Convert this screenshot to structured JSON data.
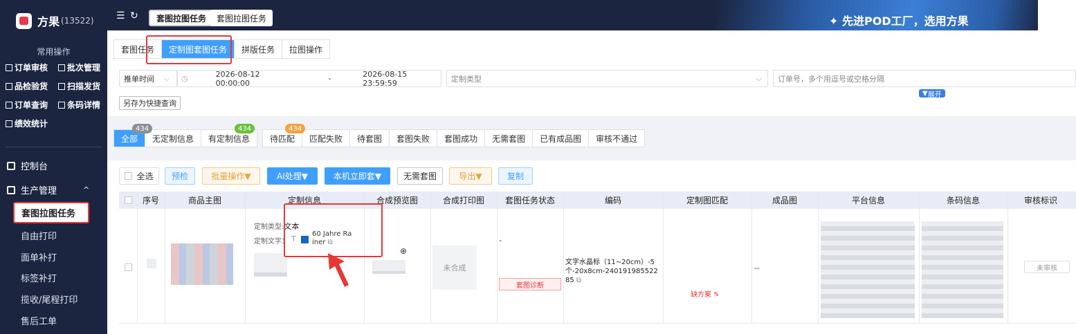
{
  "brand": {
    "name": "方果",
    "count": "(13522)"
  },
  "sidebar": {
    "quick_title": "常用操作",
    "quick_items": [
      "订单审核",
      "批次管理",
      "品检验货",
      "扫描发货",
      "订单查询",
      "条码详情",
      "绩效统计"
    ],
    "nav": [
      {
        "label": "控制台"
      },
      {
        "label": "生产管理",
        "chevron": "^"
      }
    ],
    "sub_active": "套图拉图任务",
    "sub_items": [
      "自由打印",
      "面单补打",
      "标签补打",
      "揽收/尾程打印",
      "售后工单"
    ]
  },
  "topbar": {
    "tabs": [
      "套图拉图任务",
      "套图拉图任务"
    ],
    "slogan": "先进POD工厂，选用方果"
  },
  "tabs": [
    "套图任务",
    "定制图套图任务",
    "拼版任务",
    "拉图操作"
  ],
  "filters": {
    "time_type": "推单时间",
    "start": "2026-08-12 00:00:00",
    "sep": "-",
    "end": "2026-08-15 23:59:59",
    "custom_type_placeholder": "定制类型",
    "order_placeholder": "订单号，多个用逗号或空格分隔",
    "save_quick": "另存为快捷查询",
    "expand": "展开"
  },
  "status_tabs": [
    {
      "label": "全部",
      "badge": "434"
    },
    {
      "label": "无定制信息"
    },
    {
      "label": "有定制信息",
      "badge": "434"
    },
    {
      "label": "待匹配",
      "badge": "434"
    },
    {
      "label": "匹配失败"
    },
    {
      "label": "待套图"
    },
    {
      "label": "套图失败"
    },
    {
      "label": "套图成功"
    },
    {
      "label": "无需套图"
    },
    {
      "label": "已有成品图"
    },
    {
      "label": "审核不通过"
    }
  ],
  "actions": {
    "select_all": "全选",
    "precheck": "预检",
    "batch": "批量操作",
    "ai": "AI处理",
    "local": "本机立即套",
    "no_need": "无需套图",
    "export": "导出",
    "copy": "复制"
  },
  "columns": [
    "序号",
    "商品主图",
    "定制信息",
    "合成预览图",
    "合成打印图",
    "套图任务状态",
    "编码",
    "定制图匹配",
    "成品图",
    "平台信息",
    "条码信息",
    "审核标识"
  ],
  "row": {
    "custom_type_label": "定制类型:",
    "custom_type_value": "文本",
    "custom_text_label": "定制文字1",
    "custom_text_value": "60 Jahre Rainer",
    "print_status": "未合成",
    "task_status": "-",
    "diagnose": "套图诊断",
    "code": "文字水晶标（11~20cm）-5个-20x8cm-24019198552285",
    "match": "缺方案",
    "finished": "--",
    "audit": "未审核"
  },
  "colors": {
    "sidebar": "#1b2540",
    "primary": "#409eff",
    "highlight": "#e53935",
    "orange": "#f0a340",
    "green": "#67c23a"
  }
}
